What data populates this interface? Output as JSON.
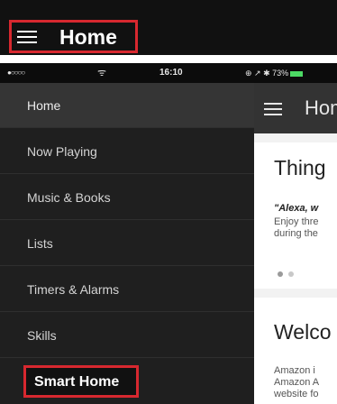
{
  "callout": {
    "title": "Home",
    "icon": "hamburger-menu-icon",
    "highlight_color": "#d7282f"
  },
  "status_bar": {
    "signal": "●○○○○",
    "wifi_icon": "wifi-icon",
    "time": "16:10",
    "indicators": "⊕ ↗ ✱ 73%"
  },
  "sidebar": {
    "items": [
      {
        "label": "Home",
        "active": true
      },
      {
        "label": "Now Playing"
      },
      {
        "label": "Music & Books"
      },
      {
        "label": "Lists"
      },
      {
        "label": "Timers & Alarms"
      },
      {
        "label": "Skills"
      },
      {
        "label": "Smart Home",
        "highlighted": true
      }
    ]
  },
  "app": {
    "header_title": "Hom",
    "card1": {
      "title": "Thing",
      "quote": "\"Alexa, w",
      "line1": "Enjoy thre",
      "line2": "during the"
    },
    "card2": {
      "title": "Welco",
      "line1": "Amazon i",
      "line2": "Amazon A",
      "line3": "website fo"
    }
  }
}
